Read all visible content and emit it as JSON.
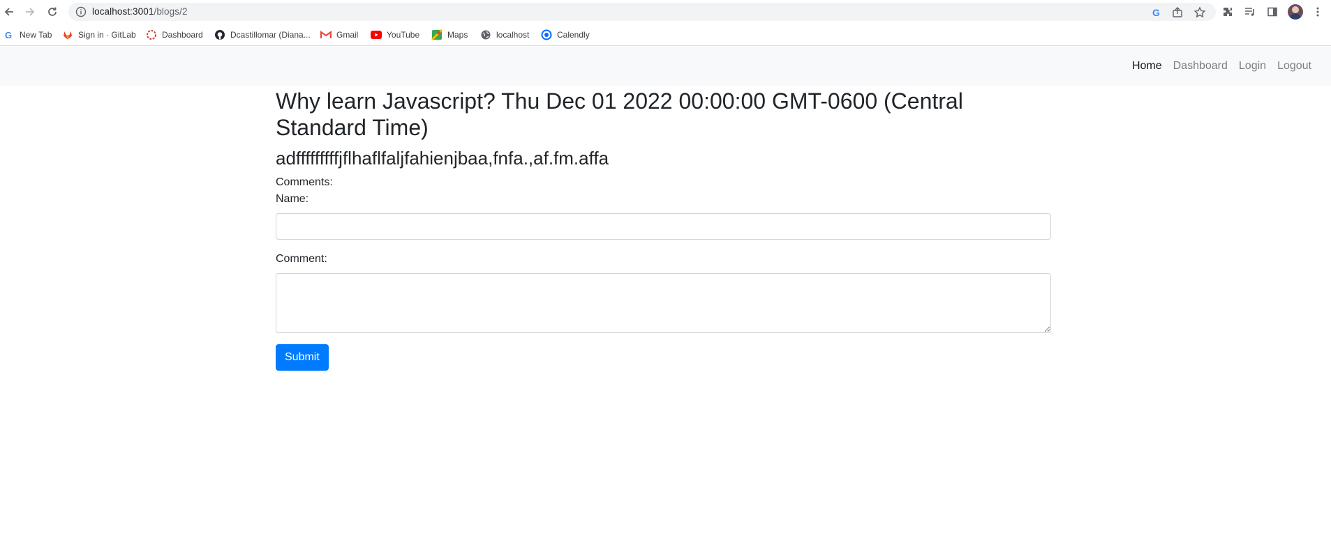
{
  "browser": {
    "url_host": "localhost:3001",
    "url_path": "/blogs/2",
    "bookmarks": [
      {
        "label": "New Tab",
        "icon": "google-icon"
      },
      {
        "label": "Sign in · GitLab",
        "icon": "gitlab-icon"
      },
      {
        "label": "Dashboard",
        "icon": "dashboard-icon"
      },
      {
        "label": "Dcastillomar (Diana...",
        "icon": "github-icon"
      },
      {
        "label": "Gmail",
        "icon": "gmail-icon"
      },
      {
        "label": "YouTube",
        "icon": "youtube-icon"
      },
      {
        "label": "Maps",
        "icon": "maps-icon"
      },
      {
        "label": "localhost",
        "icon": "globe-icon"
      },
      {
        "label": "Calendly",
        "icon": "calendly-icon"
      }
    ]
  },
  "nav": {
    "items": [
      {
        "label": "Home",
        "active": true
      },
      {
        "label": "Dashboard",
        "active": false
      },
      {
        "label": "Login",
        "active": false
      },
      {
        "label": "Logout",
        "active": false
      }
    ]
  },
  "post": {
    "title": "Why learn Javascript? Thu Dec 01 2022 00:00:00 GMT-0600 (Central Standard Time)",
    "body": "adfffffffffjflhaflfaljfahienjbaa,fnfa.,af.fm.affa"
  },
  "comments": {
    "heading": "Comments:",
    "name_label": "Name:",
    "name_value": "",
    "comment_label": "Comment:",
    "comment_value": "",
    "submit_label": "Submit"
  },
  "colors": {
    "primary": "#007bff",
    "navbar_bg": "#f8f9fa",
    "text": "#212529"
  }
}
